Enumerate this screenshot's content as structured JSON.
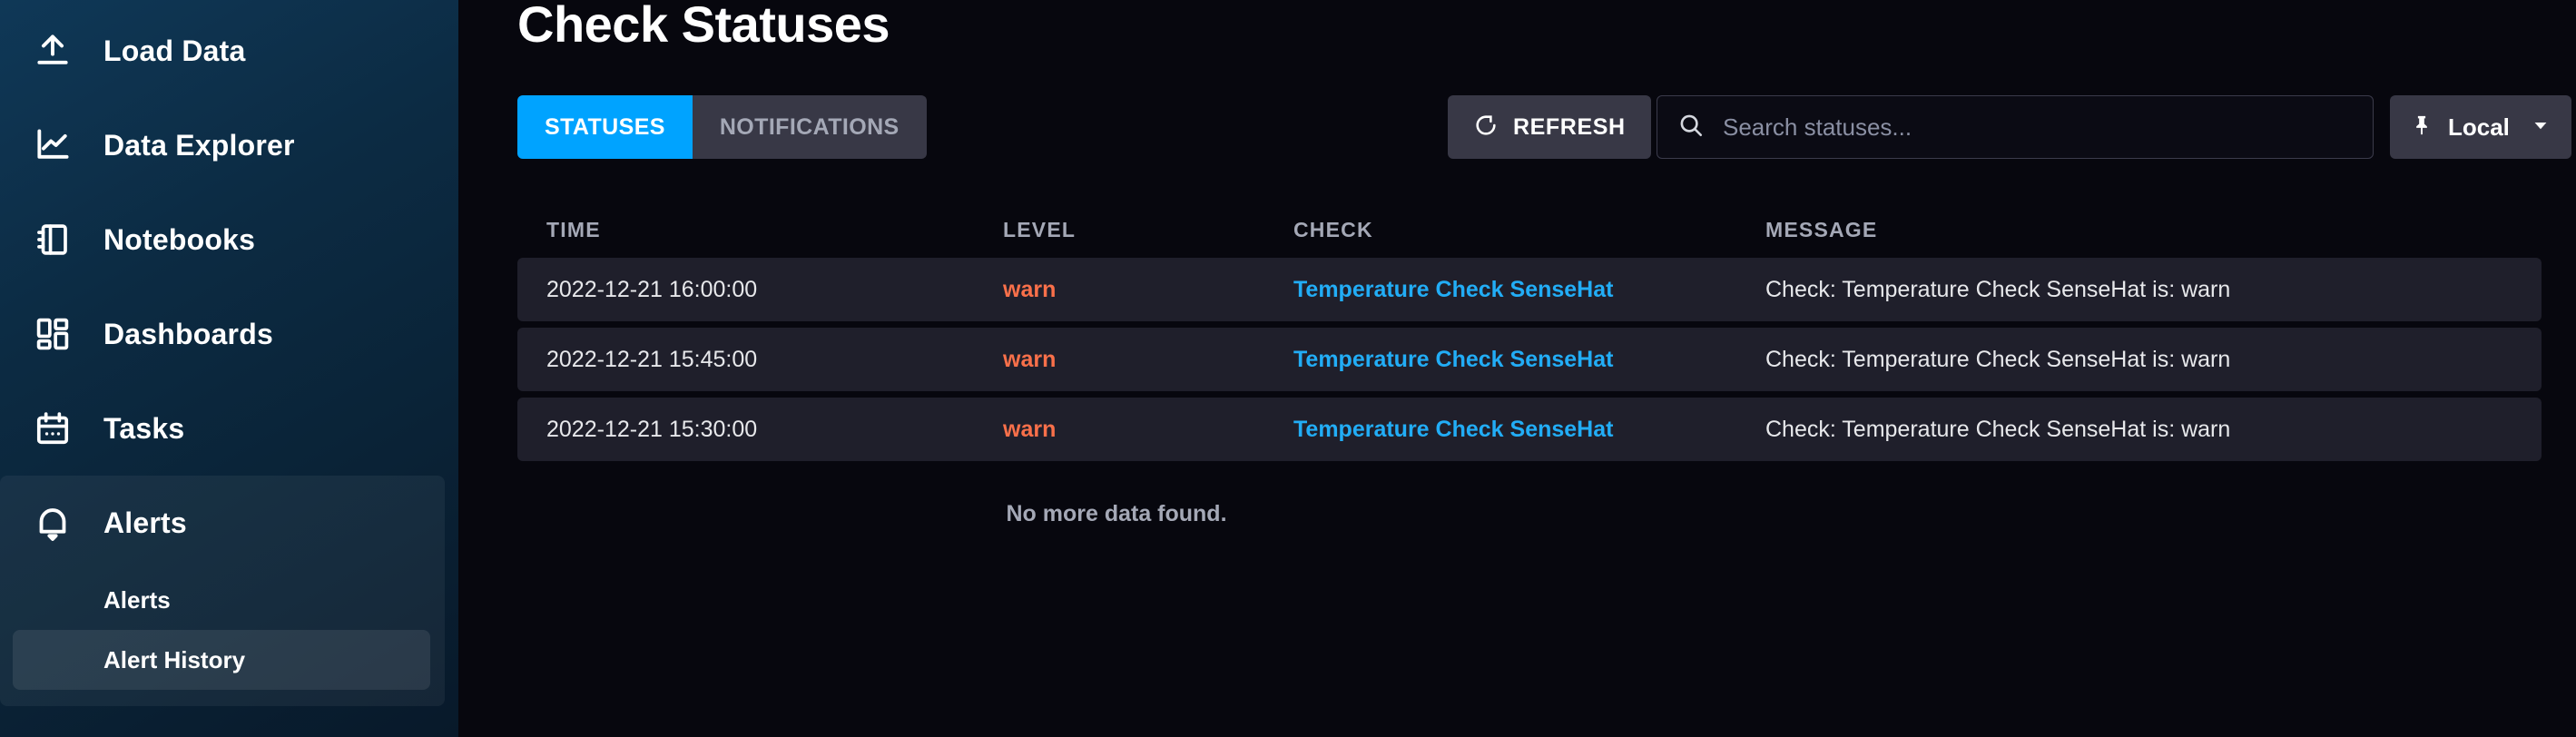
{
  "sidebar": {
    "items": [
      {
        "label": "Load Data",
        "icon": "upload-icon"
      },
      {
        "label": "Data Explorer",
        "icon": "line-chart-icon"
      },
      {
        "label": "Notebooks",
        "icon": "notebook-icon"
      },
      {
        "label": "Dashboards",
        "icon": "dashboard-grid-icon"
      },
      {
        "label": "Tasks",
        "icon": "calendar-icon"
      },
      {
        "label": "Alerts",
        "icon": "bell-icon"
      }
    ],
    "sub_items": [
      {
        "label": "Alerts",
        "active": false
      },
      {
        "label": "Alert History",
        "active": true
      }
    ]
  },
  "header": {
    "title": "Check Statuses"
  },
  "tabs": [
    {
      "label": "STATUSES",
      "active": true
    },
    {
      "label": "NOTIFICATIONS",
      "active": false
    }
  ],
  "toolbar": {
    "refresh_label": "REFRESH",
    "refresh_icon": "refresh-icon",
    "search_placeholder": "Search statuses...",
    "search_value": "",
    "search_icon": "search-icon",
    "timezone_label": "Local",
    "timezone_icon": "pin-icon",
    "timezone_caret": "chevron-down-icon"
  },
  "table": {
    "columns": [
      "TIME",
      "LEVEL",
      "CHECK",
      "MESSAGE"
    ],
    "rows": [
      {
        "time": "2022-12-21 16:00:00",
        "level": "warn",
        "check": "Temperature Check SenseHat",
        "message": "Check: Temperature Check SenseHat is: warn"
      },
      {
        "time": "2022-12-21 15:45:00",
        "level": "warn",
        "check": "Temperature Check SenseHat",
        "message": "Check: Temperature Check SenseHat is: warn"
      },
      {
        "time": "2022-12-21 15:30:00",
        "level": "warn",
        "check": "Temperature Check SenseHat",
        "message": "Check: Temperature Check SenseHat is: warn"
      }
    ],
    "footer_message": "No more data found."
  },
  "colors": {
    "accent_blue": "#00a3ff",
    "link_blue": "#22adf6",
    "warn_orange": "#f9704a",
    "row_bg": "#1f1f2b",
    "main_bg": "#07070e"
  }
}
